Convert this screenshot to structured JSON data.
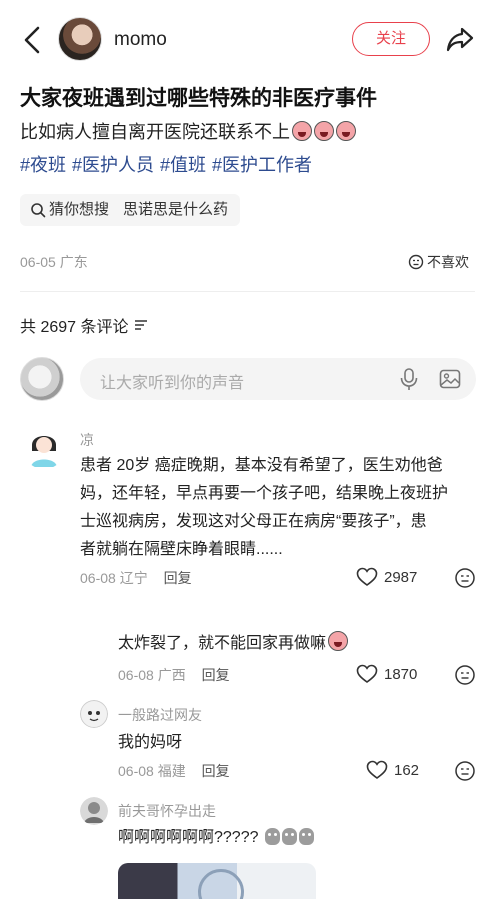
{
  "header": {
    "username": "momo",
    "follow_label": "关注"
  },
  "post": {
    "title": "大家夜班遇到过哪些特殊的非医疗事件",
    "description": "比如病人擅自离开医院还联系不上",
    "tags": [
      "#夜班",
      "#医护人员",
      "#值班",
      "#医护工作者"
    ],
    "guess_label": "猜你想搜",
    "guess_query": "思诺思是什么药",
    "date": "06-05",
    "location": "广东",
    "dislike_label": "不喜欢"
  },
  "comments_header": {
    "count_label": "共 2697 条评论"
  },
  "composer": {
    "placeholder": "让大家听到你的声音"
  },
  "comments": [
    {
      "name": "凉",
      "lines": [
        "患者 20岁 癌症晚期，基本没有希望了，医生劝他爸",
        "妈，还年轻，早点再要一个孩子吧，结果晚上夜班护",
        "士巡视病房，发现这对父母正在病房“要孩子”，患",
        "者就躺在隔壁床睁着眼睛......"
      ],
      "date": "06-08",
      "location": "辽宁",
      "reply_label": "回复",
      "likes": "2987"
    },
    {
      "name": "",
      "text": "太炸裂了，就不能回家再做嘛",
      "date": "06-08",
      "location": "广西",
      "reply_label": "回复",
      "likes": "1870"
    },
    {
      "name": "一般路过网友",
      "text": "我的妈呀",
      "date": "06-08",
      "location": "福建",
      "reply_label": "回复",
      "likes": "162"
    },
    {
      "name": "前夫哥怀孕出走",
      "text": "啊啊啊啊啊啊?????"
    }
  ],
  "colors": {
    "accent": "#e8414c",
    "tag": "#2d4b8f",
    "muted": "#999999"
  },
  "icons": [
    "back-arrow-icon",
    "share-icon",
    "search-icon",
    "dislike-face-icon",
    "sort-icon",
    "microphone-icon",
    "image-icon",
    "heart-icon",
    "more-face-icon"
  ]
}
